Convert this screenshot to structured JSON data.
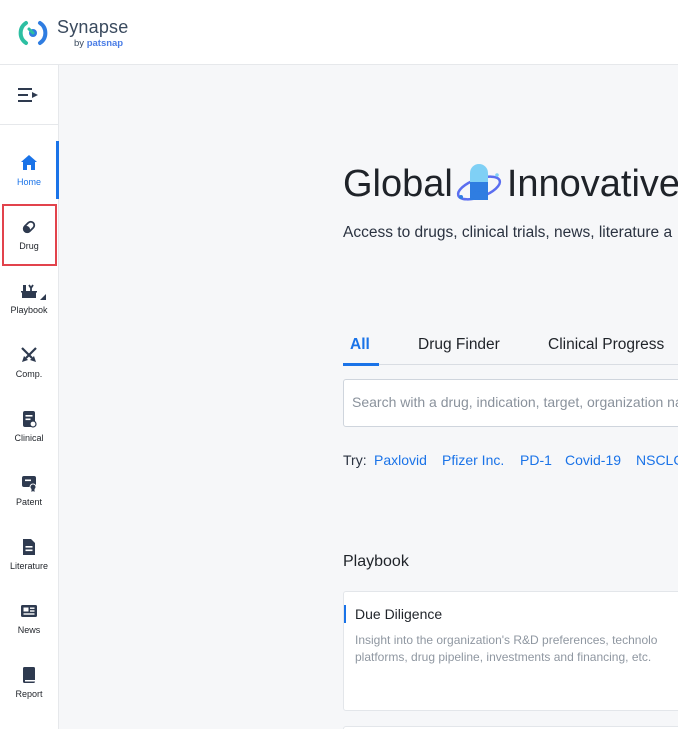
{
  "brand": {
    "name": "Synapse",
    "by": "by ",
    "company": "patsnap"
  },
  "sidebar": {
    "items": [
      {
        "label": "Home",
        "icon": "home-icon"
      },
      {
        "label": "Drug",
        "icon": "pill-icon"
      },
      {
        "label": "Playbook",
        "icon": "playbook-icon"
      },
      {
        "label": "Comp.",
        "icon": "crossed-swords-icon"
      },
      {
        "label": "Clinical",
        "icon": "clinical-icon"
      },
      {
        "label": "Patent",
        "icon": "patent-icon"
      },
      {
        "label": "Literature",
        "icon": "document-icon"
      },
      {
        "label": "News",
        "icon": "newspaper-icon"
      },
      {
        "label": "Report",
        "icon": "book-icon"
      }
    ],
    "active": "Home",
    "highlighted": "Drug"
  },
  "hero": {
    "title_left": "Global",
    "title_right": "Innovative",
    "subtitle": "Access to drugs, clinical trials, news, literature a"
  },
  "tabs": [
    {
      "label": "All"
    },
    {
      "label": "Drug Finder"
    },
    {
      "label": "Clinical Progress"
    }
  ],
  "search": {
    "placeholder": "Search with a drug, indication, target, organization na"
  },
  "try": {
    "label": "Try:",
    "links": [
      "Paxlovid",
      "Pfizer Inc.",
      "PD-1",
      "Covid-19",
      "NSCLC"
    ]
  },
  "playbook": {
    "title": "Playbook",
    "cards": [
      {
        "title": "Due Diligence",
        "desc_line1": "Insight into the organization's R&D preferences, technolo",
        "desc_line2": "platforms, drug pipeline, investments and financing, etc."
      }
    ]
  },
  "colors": {
    "accent": "#1a73e8",
    "highlight_border": "#e2434c",
    "sidebar_icon": "#2e3a4f"
  }
}
